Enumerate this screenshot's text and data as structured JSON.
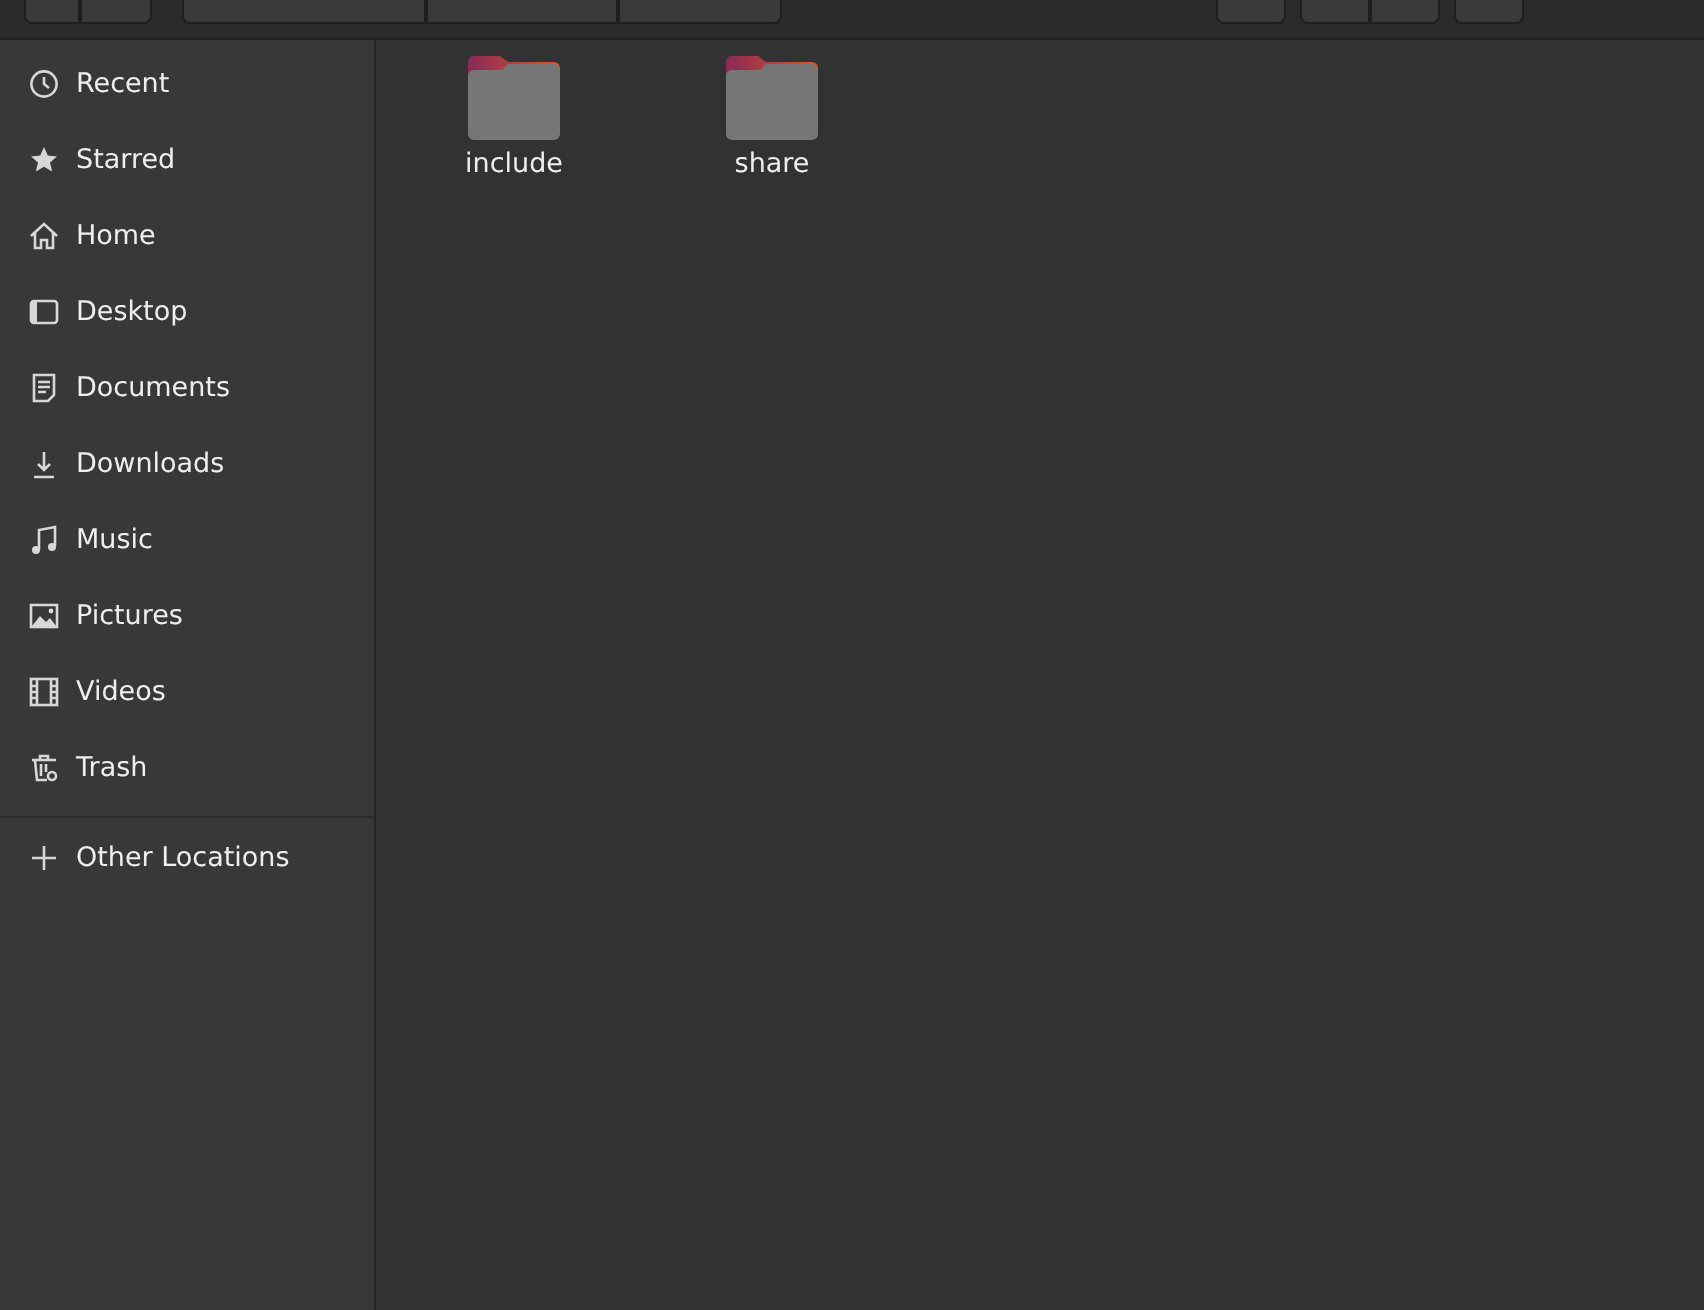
{
  "sidebar": {
    "places": [
      {
        "kind": "recent",
        "label": "Recent"
      },
      {
        "kind": "starred",
        "label": "Starred"
      },
      {
        "kind": "home",
        "label": "Home"
      },
      {
        "kind": "desktop",
        "label": "Desktop"
      },
      {
        "kind": "documents",
        "label": "Documents"
      },
      {
        "kind": "downloads",
        "label": "Downloads"
      },
      {
        "kind": "music",
        "label": "Music"
      },
      {
        "kind": "pictures",
        "label": "Pictures"
      },
      {
        "kind": "videos",
        "label": "Videos"
      },
      {
        "kind": "trash",
        "label": "Trash"
      }
    ],
    "other": [
      {
        "kind": "add",
        "label": "Other Locations"
      }
    ]
  },
  "files": [
    {
      "kind": "folder",
      "name": "include"
    },
    {
      "kind": "folder",
      "name": "share"
    }
  ]
}
